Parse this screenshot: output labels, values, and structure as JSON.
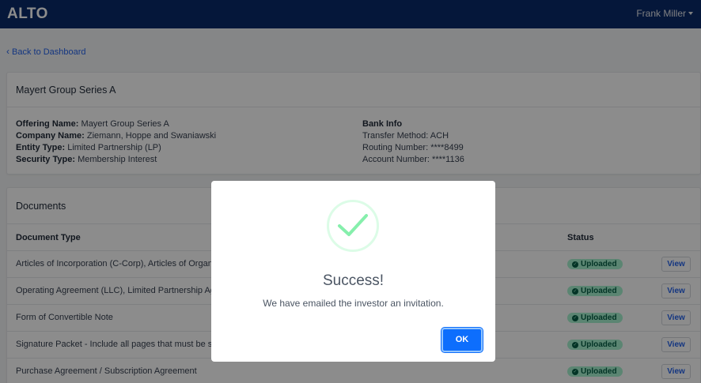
{
  "header": {
    "logo": "ALTO",
    "user_name": "Frank Miller"
  },
  "back_link": "Back to Dashboard",
  "offering": {
    "title": "Mayert Group Series A",
    "fields": [
      {
        "label": "Offering Name:",
        "value": "Mayert Group Series A"
      },
      {
        "label": "Company Name:",
        "value": "Ziemann, Hoppe and Swaniawski"
      },
      {
        "label": "Entity Type:",
        "value": "Limited Partnership (LP)"
      },
      {
        "label": "Security Type:",
        "value": "Membership Interest"
      }
    ],
    "bank": {
      "title": "Bank Info",
      "lines": [
        "Transfer Method: ACH",
        "Routing Number: ****8499",
        "Account Number: ****1136"
      ]
    }
  },
  "documents": {
    "title": "Documents",
    "col_type": "Document Type",
    "col_status": "Status",
    "rows": [
      {
        "name": "Articles of Incorporation (C-Corp), Articles of Organization (LLC), Certificate of Limited Partnership (LP)",
        "status": "Uploaded",
        "action": "View"
      },
      {
        "name": "Operating Agreement (LLC), Limited Partnership Agreement (LP), Bylaws (C-Corp)",
        "status": "Uploaded",
        "action": "View"
      },
      {
        "name": "Form of Convertible Note",
        "status": "Uploaded",
        "action": "View"
      },
      {
        "name": "Signature Packet - Include all pages that must be signed by the investor",
        "status": "Uploaded",
        "action": "View"
      },
      {
        "name": "Purchase Agreement / Subscription Agreement",
        "status": "Uploaded",
        "action": "View"
      }
    ]
  },
  "modal": {
    "title": "Success!",
    "message": "We have emailed the investor an invitation.",
    "ok_label": "OK"
  },
  "colors": {
    "topbar": "#0a2a6b",
    "accent": "#0d6efd",
    "success": "#86efac",
    "badge_bg": "#a7f3d0"
  }
}
